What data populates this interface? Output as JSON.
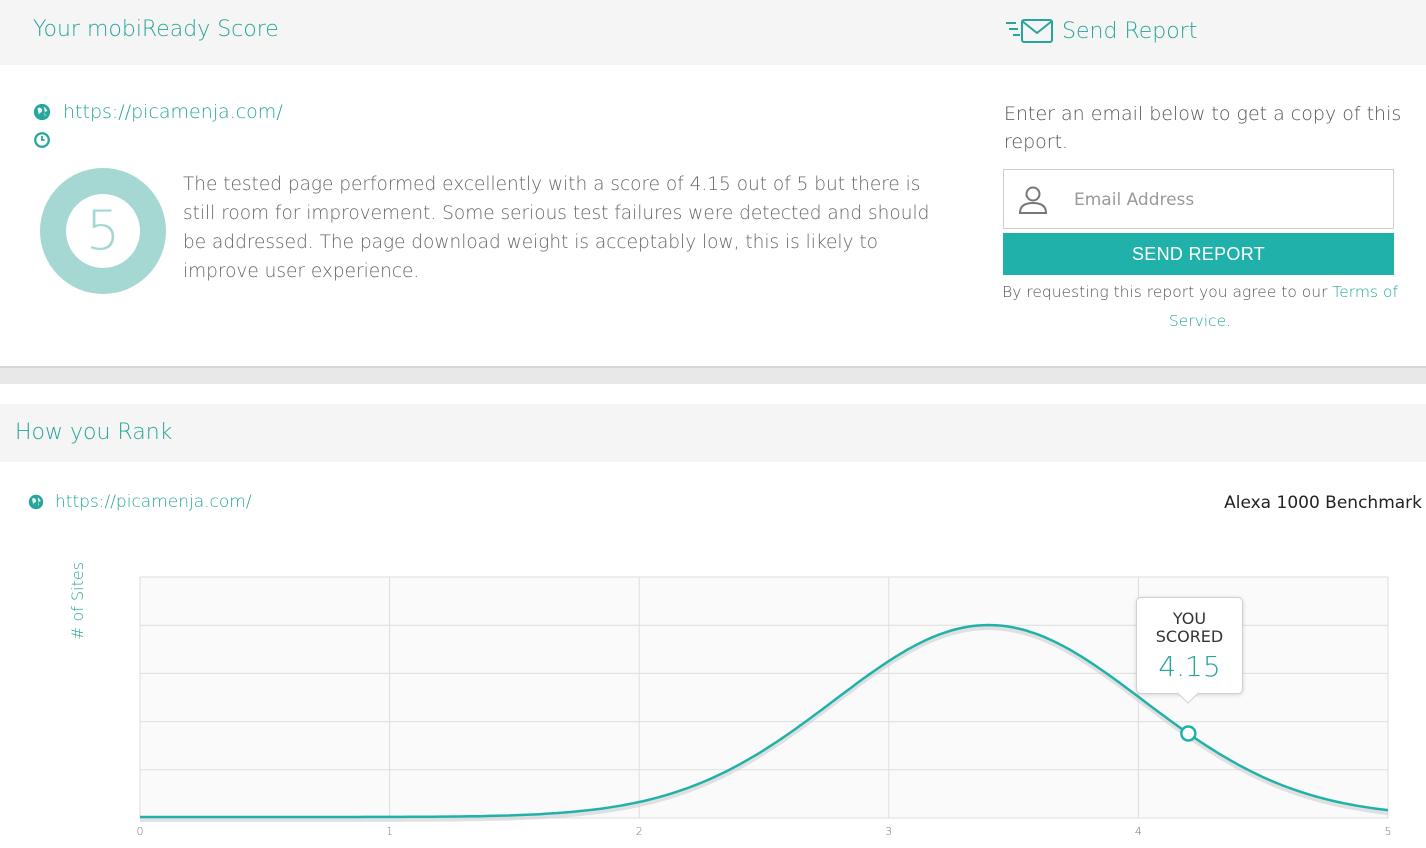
{
  "score_panel": {
    "title": "Your mobiReady Score",
    "url": "https://picamenja.com/",
    "score": "5",
    "description": "The tested page performed excellently with a score of 4.15 out of 5 but there is still room for improvement. Some serious test failures were detected and should be addressed. The page download weight is acceptably low, this is likely to improve user experience."
  },
  "send_report": {
    "title": "Send Report",
    "prompt": "Enter an email below to get a copy of this report.",
    "email_placeholder": "Email Address",
    "button_label": "SEND REPORT",
    "terms_prefix": "By requesting this report you agree to our ",
    "terms_link": "Terms of Service",
    "terms_suffix": "."
  },
  "rank_panel": {
    "title": "How you Rank",
    "url": "https://picamenja.com/",
    "benchmark": "Alexa 1000 Benchmark"
  },
  "colors": {
    "accent": "#26a69a",
    "button": "#20b2aa",
    "score_ring": "#a6d8d3"
  },
  "icons": {
    "send_report": "envelope-fast-icon",
    "url": "globe-icon",
    "time": "clock-icon",
    "email": "user-icon"
  },
  "chart_data": {
    "type": "area",
    "ylabel": "# of Sites",
    "xlabel": "",
    "xlim": [
      0,
      5
    ],
    "x_ticks": [
      "0",
      "1",
      "2",
      "3",
      "4",
      "5"
    ],
    "distribution": {
      "mean": 3.4,
      "std": 0.62
    },
    "marker": {
      "x": 4.2,
      "tooltip_line1": "YOU",
      "tooltip_line2": "SCORED",
      "tooltip_value": "4.15"
    }
  }
}
